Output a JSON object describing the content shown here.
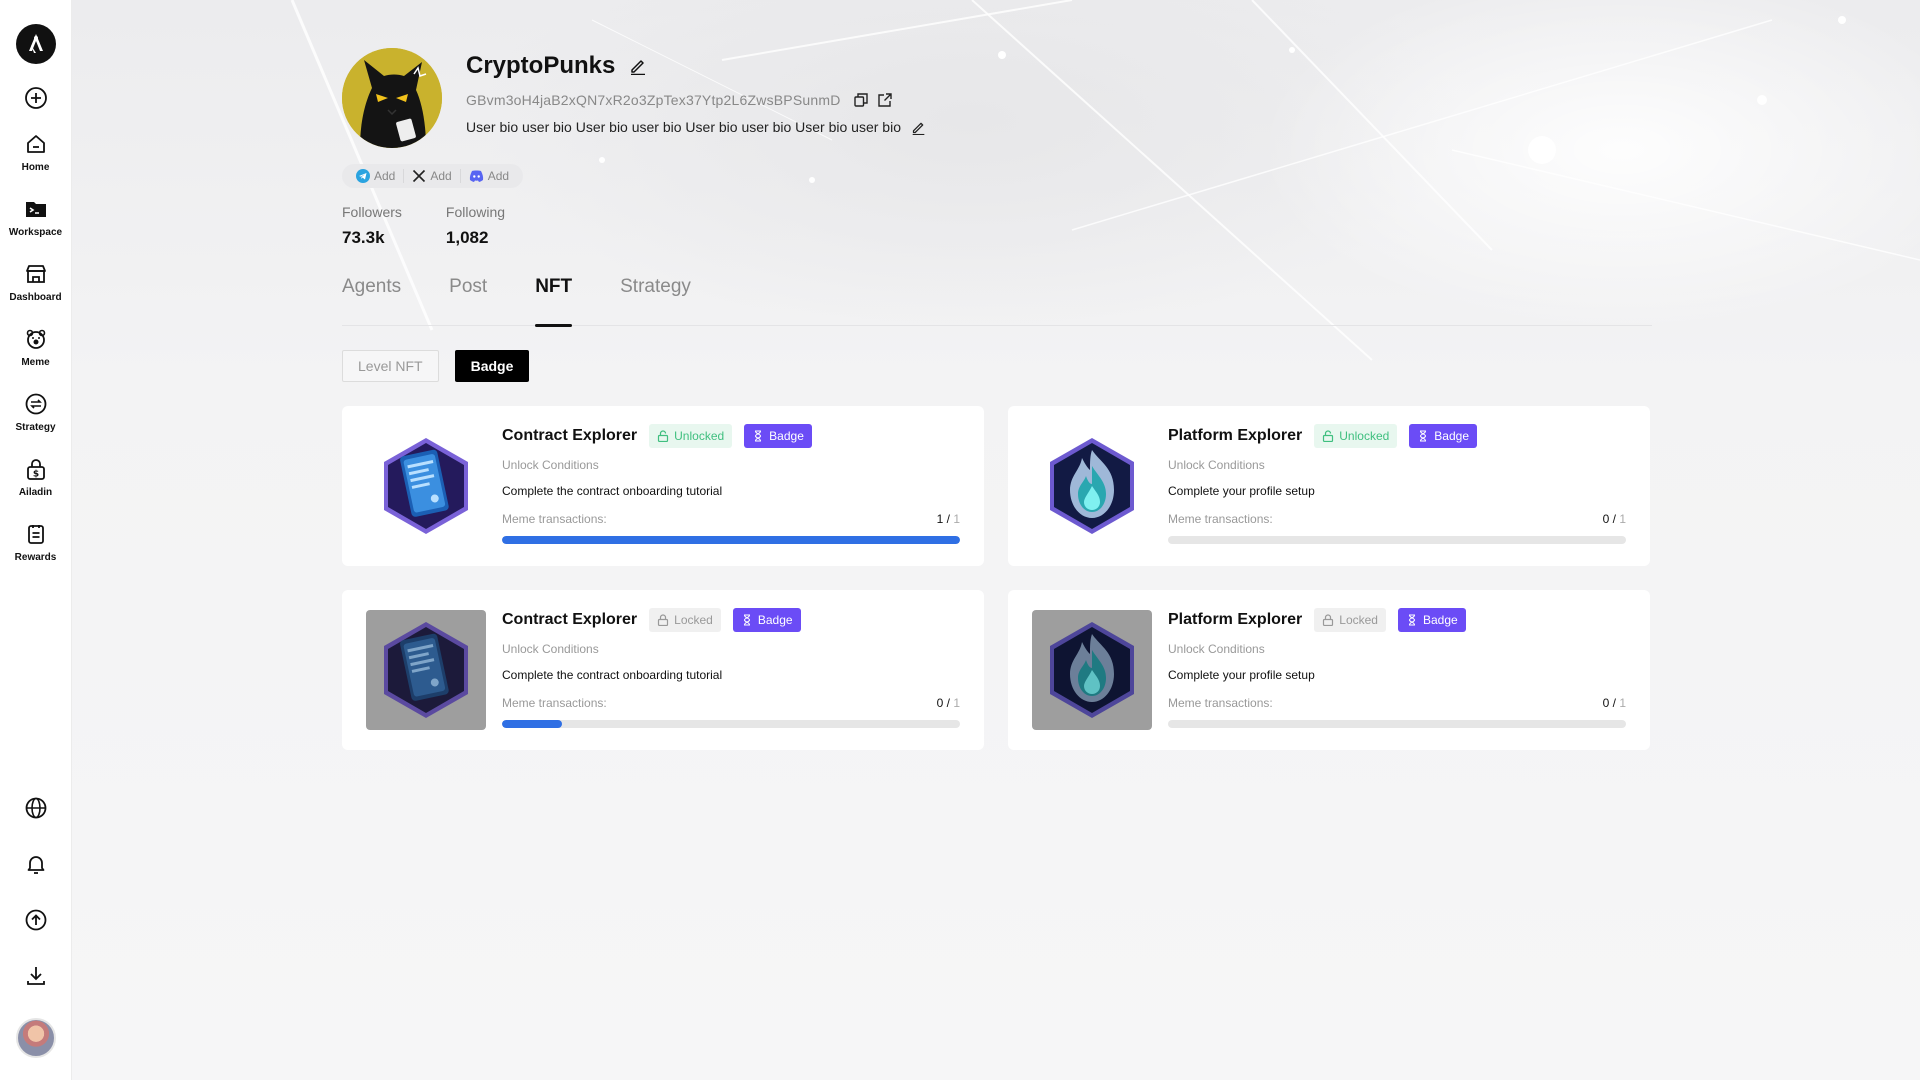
{
  "sidebar": {
    "nav": [
      {
        "label": "Home",
        "icon": "home-icon"
      },
      {
        "label": "Workspace",
        "icon": "terminal-folder-icon"
      },
      {
        "label": "Dashboard",
        "icon": "store-icon"
      },
      {
        "label": "Meme",
        "icon": "bear-icon"
      },
      {
        "label": "Strategy",
        "icon": "strategy-icon"
      },
      {
        "label": "Ailadin",
        "icon": "dollar-lock-icon"
      },
      {
        "label": "Rewards",
        "icon": "clipboard-icon"
      }
    ]
  },
  "profile": {
    "name": "CryptoPunks",
    "address": "GBvm3oH4jaB2xQN7xR2o3ZpTex37Ytp2L6ZwsBPSunmD",
    "bio": "User bio user bio User bio user bio User bio user bio User bio user bio",
    "socials": [
      {
        "icon": "telegram-icon",
        "label": "Add"
      },
      {
        "icon": "x-icon",
        "label": "Add"
      },
      {
        "icon": "discord-icon",
        "label": "Add"
      }
    ],
    "stats": [
      {
        "label": "Followers",
        "value": "73.3k"
      },
      {
        "label": "Following",
        "value": "1,082"
      }
    ]
  },
  "tabs": [
    {
      "label": "Agents",
      "active": false
    },
    {
      "label": "Post",
      "active": false
    },
    {
      "label": "NFT",
      "active": true
    },
    {
      "label": "Strategy",
      "active": false
    }
  ],
  "subtabs": [
    {
      "label": "Level NFT",
      "active": false
    },
    {
      "label": "Badge",
      "active": true
    }
  ],
  "cards": [
    {
      "title": "Contract Explorer",
      "status": "Unlocked",
      "type": "Badge",
      "conditions_label": "Unlock Conditions",
      "description": "Complete the contract onboarding tutorial",
      "progress_label": "Meme transactions:",
      "progress_value": "1",
      "progress_total": "1",
      "progress_fraction": 1.0,
      "image": "contract",
      "locked": false
    },
    {
      "title": "Platform Explorer",
      "status": "Unlocked",
      "type": "Badge",
      "conditions_label": "Unlock Conditions",
      "description": "Complete your profile setup",
      "progress_label": "Meme transactions:",
      "progress_value": "0",
      "progress_total": "1",
      "progress_fraction": 0.0,
      "image": "flame",
      "locked": false
    },
    {
      "title": "Contract Explorer",
      "status": "Locked",
      "type": "Badge",
      "conditions_label": "Unlock Conditions",
      "description": "Complete the contract onboarding tutorial",
      "progress_label": "Meme transactions:",
      "progress_value": "0",
      "progress_total": "1",
      "progress_fraction": 0.13,
      "image": "contract",
      "locked": true
    },
    {
      "title": "Platform Explorer",
      "status": "Locked",
      "type": "Badge",
      "conditions_label": "Unlock Conditions",
      "description": "Complete your profile setup",
      "progress_label": "Meme transactions:",
      "progress_value": "0",
      "progress_total": "1",
      "progress_fraction": 0.0,
      "image": "flame",
      "locked": true
    }
  ],
  "colors": {
    "accent_blue": "#2f6fe4",
    "badge_purple": "#6b4cf6",
    "unlocked_green": "#3fbf7f"
  }
}
